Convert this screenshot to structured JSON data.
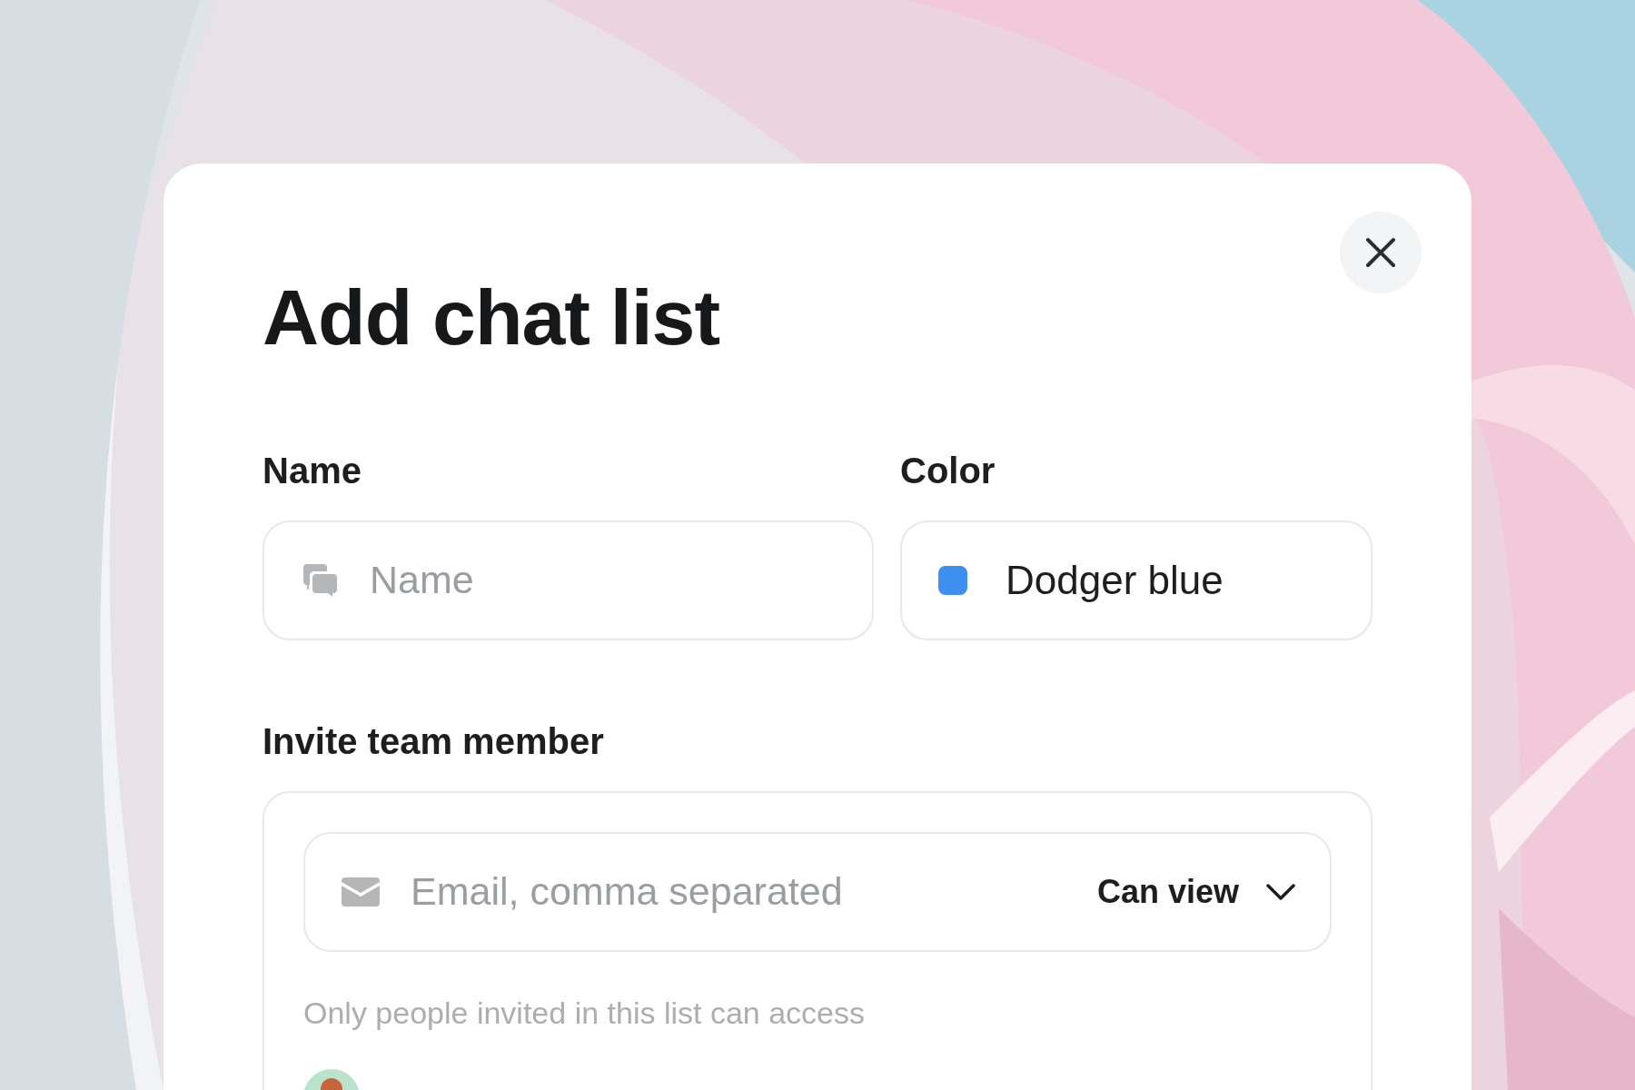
{
  "dialog": {
    "title": "Add chat list",
    "fields": [
      {
        "kind": "text",
        "label": "Name",
        "placeholder": "Name"
      },
      {
        "kind": "color",
        "label": "Color",
        "value": "Dodger blue",
        "color": "#3d8ff0"
      }
    ],
    "invite": {
      "label": "Invite team member",
      "placeholder": "Email, comma separated",
      "permission": "Can view",
      "note": "Only people invited in this list can access"
    }
  }
}
